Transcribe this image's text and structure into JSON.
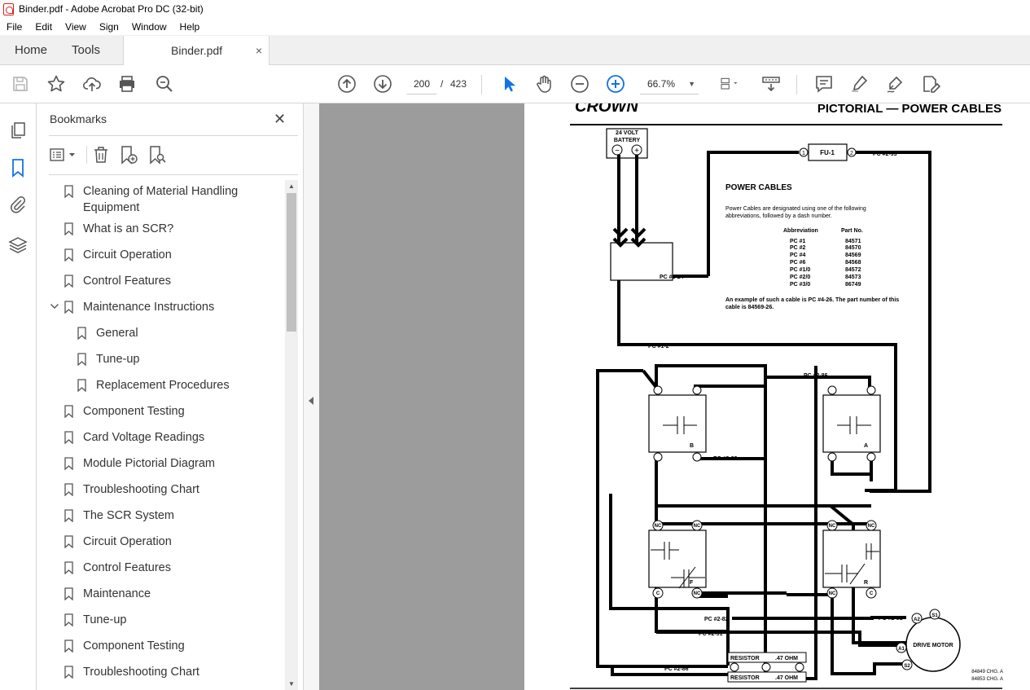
{
  "window": {
    "title": "Binder.pdf - Adobe Acrobat Pro DC (32-bit)"
  },
  "menu": [
    "File",
    "Edit",
    "View",
    "Sign",
    "Window",
    "Help"
  ],
  "tabs": {
    "home": "Home",
    "tools": "Tools",
    "doc": "Binder.pdf",
    "close": "×"
  },
  "toolbar": {
    "page_current": "200",
    "page_sep": "/",
    "page_total": "423",
    "zoom": "66.7%"
  },
  "panel": {
    "title": "Bookmarks",
    "close": "✕",
    "items": [
      {
        "label": "Cleaning of Material Handling",
        "label2": "Equipment"
      },
      {
        "label": "What is an SCR?"
      },
      {
        "label": "Circuit Operation"
      },
      {
        "label": "Control Features"
      },
      {
        "label": "Maintenance Instructions",
        "expanded": true
      },
      {
        "label": "General"
      },
      {
        "label": "Tune-up"
      },
      {
        "label": "Replacement Procedures"
      },
      {
        "label": "Component Testing"
      },
      {
        "label": "Card Voltage Readings"
      },
      {
        "label": "Module Pictorial Diagram"
      },
      {
        "label": "Troubleshooting Chart"
      },
      {
        "label": "The SCR System"
      },
      {
        "label": "Circuit Operation"
      },
      {
        "label": "Control Features"
      },
      {
        "label": "Maintenance"
      },
      {
        "label": "Tune-up"
      },
      {
        "label": "Component Testing"
      },
      {
        "label": "Troubleshooting Chart"
      }
    ]
  },
  "doc": {
    "logo": "CROWN",
    "header": "PICTORIAL — POWER CABLES",
    "battery": "24 VOLT BATTERY",
    "minus": "−",
    "plus": "+",
    "fuse": "FU-1",
    "term1": "1",
    "term2": "2",
    "box_title": "POWER CABLES",
    "box_text1": "Power Cables are designated using one of the following",
    "box_text2": "abbreviations, followed by a dash number.",
    "col_abbr": "Abbreviation",
    "col_part": "Part No.",
    "table": [
      [
        "PC #1",
        "84571"
      ],
      [
        "PC #2",
        "84570"
      ],
      [
        "PC #4",
        "84569"
      ],
      [
        "PC #6",
        "84568"
      ],
      [
        "PC #1/0",
        "84572"
      ],
      [
        "PC #2/0",
        "84573"
      ],
      [
        "PC #3/0",
        "86749"
      ]
    ],
    "example1": "An example of such a cable is PC #4-26. The part number of this",
    "example2": "cable is 84569-26.",
    "labels": {
      "pc293_top": "PC #2-93",
      "pc124": "PC #1-24",
      "pc12": "PC #1-2",
      "pc286_top": "PC #2-86",
      "pc293_mid": "PC #2-93",
      "pc282": "PC #2-82",
      "pc291_low": "PC #2-91",
      "pc291_right": "PC #2-91",
      "pc286_bottom": "PC #2-86"
    },
    "contactors": {
      "b": "B",
      "a": "A",
      "f": "F",
      "r": "R"
    },
    "nc": "NC",
    "c": "C",
    "resistor": "RESISTOR",
    "ohm": ".47 OHM",
    "motor": "DRIVE MOTOR",
    "a1": "A1",
    "a2": "A2",
    "s1": "S1",
    "s2": "S2",
    "chg1": "84849 CHG. A",
    "chg2": "84853 CHG. A"
  }
}
